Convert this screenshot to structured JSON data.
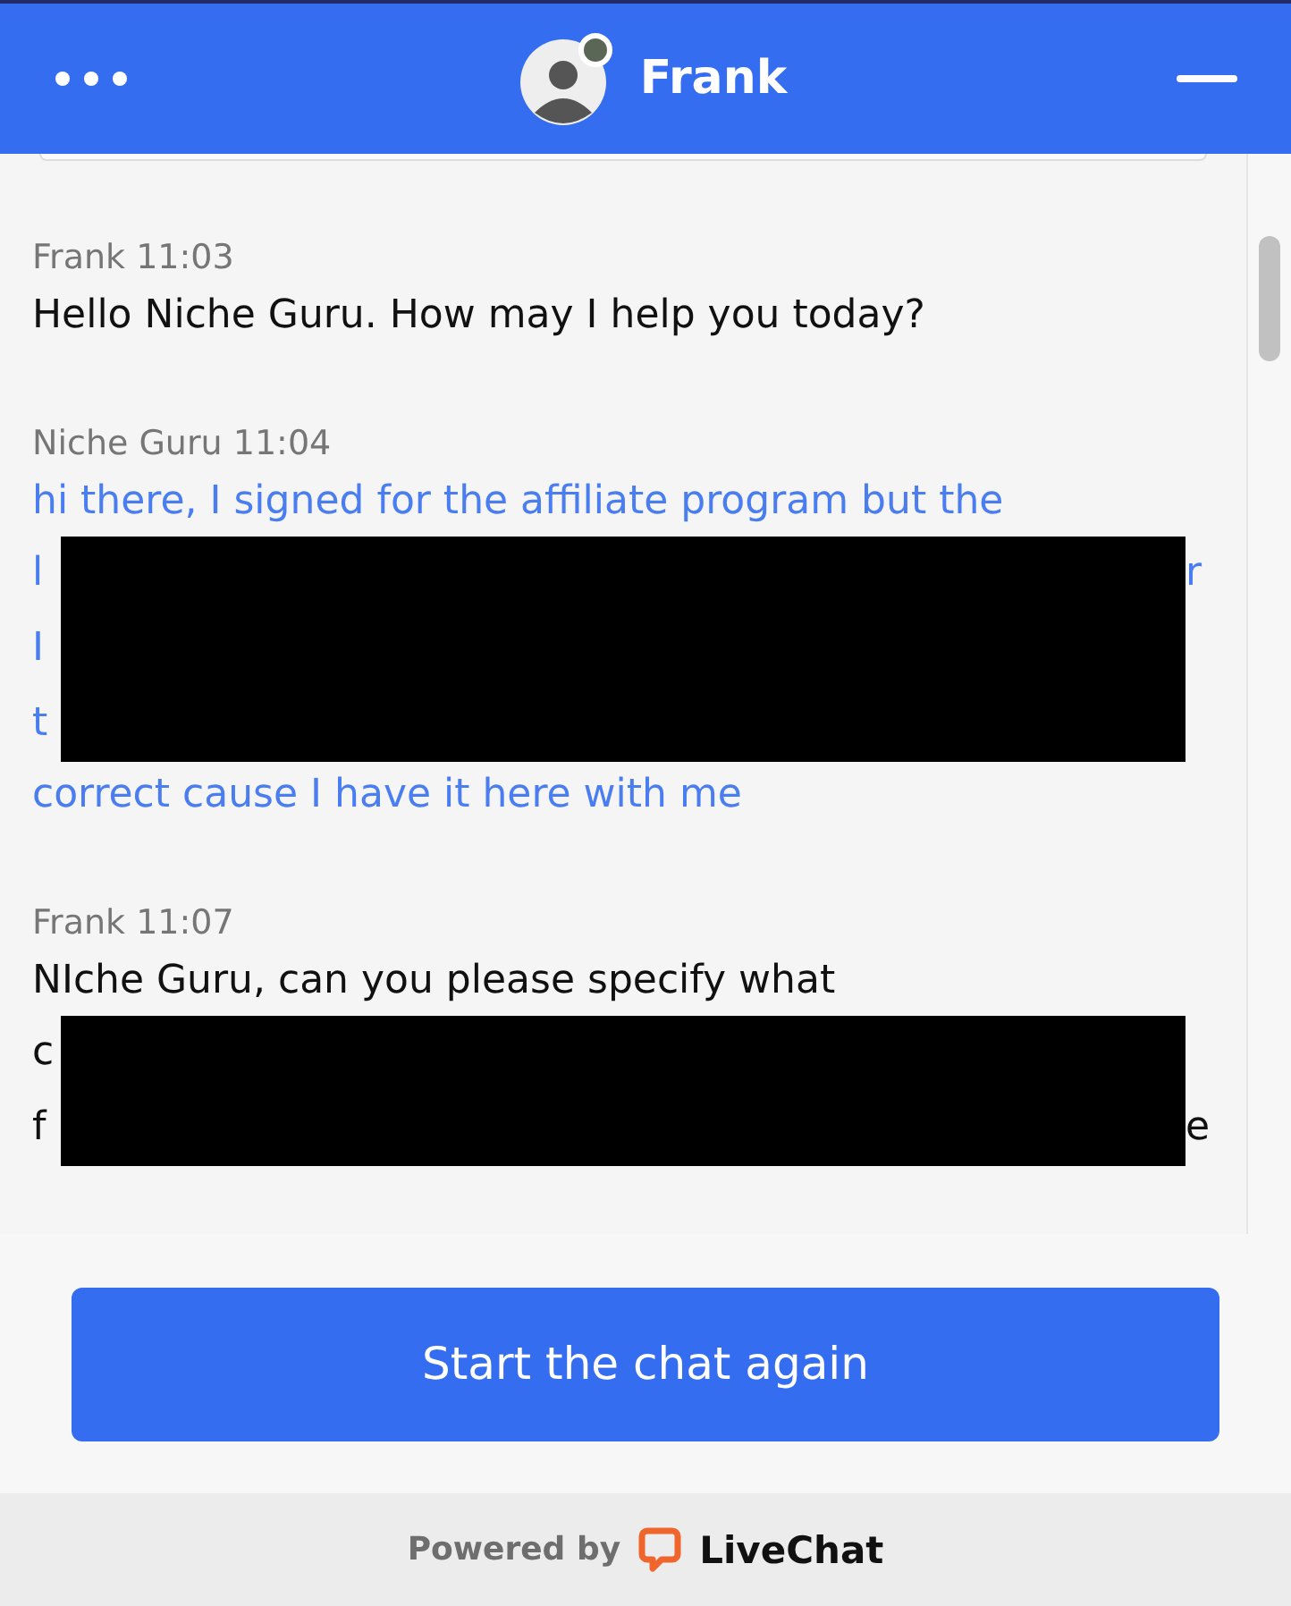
{
  "header": {
    "title": "Frank",
    "agent_online": true
  },
  "messages": [
    {
      "author": "Frank 11:03",
      "kind": "agent",
      "first_line": "Hello Niche Guru. How may I help you today?"
    },
    {
      "author": "Niche Guru 11:04",
      "kind": "visitor",
      "first_line": "hi there, I signed for the affiliate program but the",
      "redacted_rows": [
        {
          "left": "l",
          "right": "r"
        },
        {
          "left": "I",
          "right": ""
        },
        {
          "left": "t",
          "right": ""
        }
      ],
      "last_line": "correct cause I have it here with me"
    },
    {
      "author": "Frank 11:07",
      "kind": "agent",
      "first_line": "NIche Guru, can you please specify what",
      "redacted_rows": [
        {
          "left": "c",
          "right": ""
        },
        {
          "left": "f",
          "right": "e"
        }
      ]
    }
  ],
  "restart_button": "Start the chat again",
  "footer": {
    "prefix": "Powered by",
    "brand": "LiveChat"
  }
}
